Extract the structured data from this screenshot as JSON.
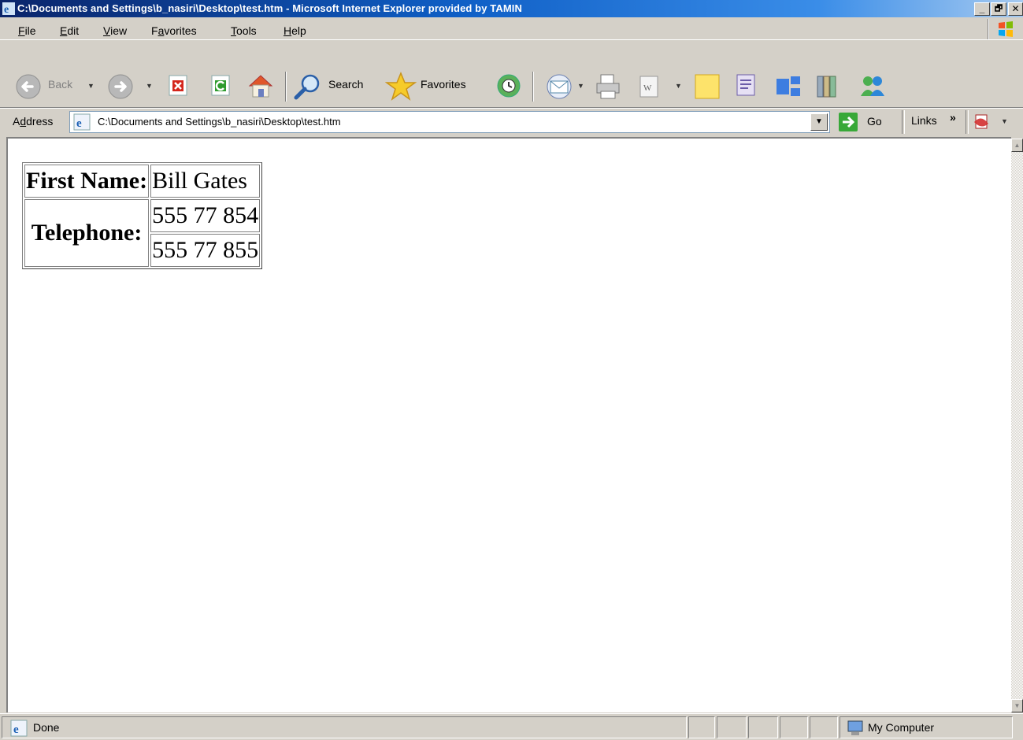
{
  "window": {
    "title": "C:\\Documents and Settings\\b_nasiri\\Desktop\\test.htm - Microsoft Internet Explorer provided by TAMIN",
    "minimize": "_",
    "maximize": "🗗",
    "close": "✕"
  },
  "menu": {
    "file": {
      "u": "F",
      "rest": "ile"
    },
    "edit": {
      "u": "E",
      "rest": "dit"
    },
    "view": {
      "u": "V",
      "rest": "iew"
    },
    "favorites": {
      "pre": "F",
      "u": "a",
      "rest": "vorites"
    },
    "tools": {
      "u": "T",
      "rest": "ools"
    },
    "help": {
      "u": "H",
      "rest": "elp"
    }
  },
  "toolbar": {
    "back": "Back",
    "search": "Search",
    "favorites": "Favorites"
  },
  "address": {
    "label_pre": "A",
    "label_u": "d",
    "label_rest": "dress",
    "url": "C:\\Documents and Settings\\b_nasiri\\Desktop\\test.htm",
    "go": "Go",
    "links": "Links",
    "links_more": "»"
  },
  "table": {
    "first_name_label": "First Name:",
    "first_name_value": "Bill Gates",
    "telephone_label": "Telephone:",
    "phones": [
      "555 77 854",
      "555 77 855"
    ]
  },
  "status": {
    "text": "Done",
    "zone": "My Computer"
  }
}
